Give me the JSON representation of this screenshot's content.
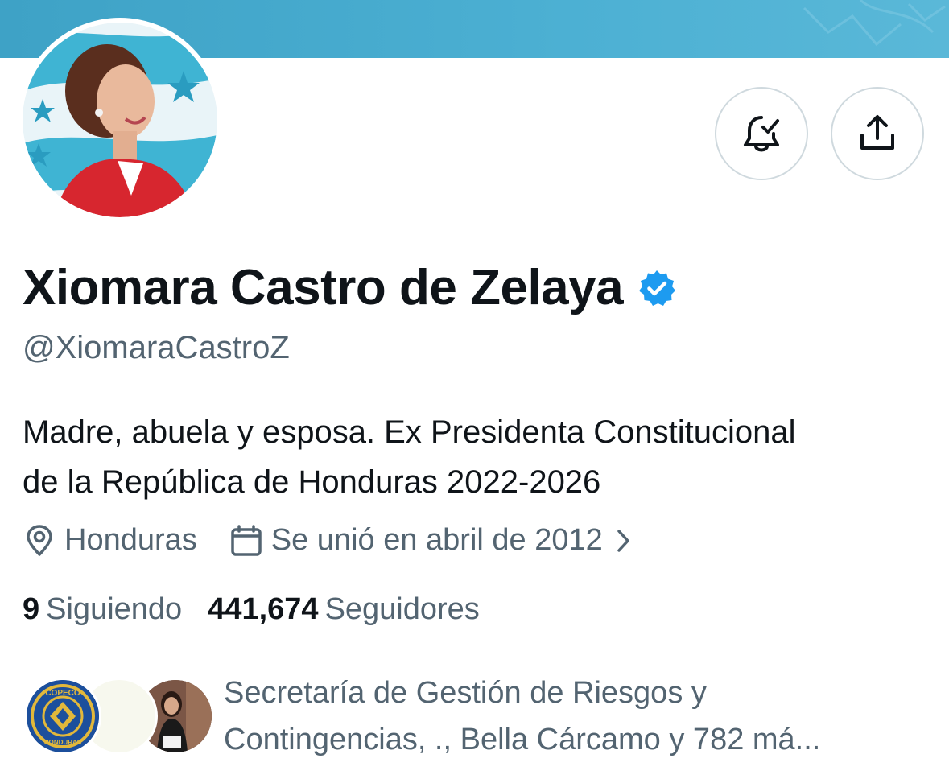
{
  "profile": {
    "display_name": "Xiomara Castro de Zelaya",
    "handle": "@XiomaraCastroZ",
    "verified": true,
    "bio_line1": "Madre, abuela y esposa. Ex Presidenta Constitucional",
    "bio_line2": "de la República de Honduras 2022-2026",
    "location": "Honduras",
    "joined": "Se unió en abril de 2012"
  },
  "stats": {
    "following_count": "9",
    "following_label": "Siguiendo",
    "followers_count": "441,674",
    "followers_label": "Seguidores"
  },
  "followers_you_know": {
    "line1": "Secretaría de Gestión de Riesgos y",
    "line2": "Contingencias, ., Bella Cárcamo y 782 má...",
    "avatar1_text": "COPECO",
    "avatar1_sub": "HONDURAS"
  },
  "icons": {
    "notifications": "bell-check-icon",
    "share": "share-upload-icon",
    "location": "location-pin-icon",
    "calendar": "calendar-icon",
    "chevron": "chevron-right-icon",
    "verified": "verified-badge-icon"
  },
  "colors": {
    "banner": "#4cb0d3",
    "verified": "#1d9bf0",
    "secondary_text": "#536471",
    "primary_text": "#0f1419",
    "avatar_jacket": "#d7262f"
  }
}
